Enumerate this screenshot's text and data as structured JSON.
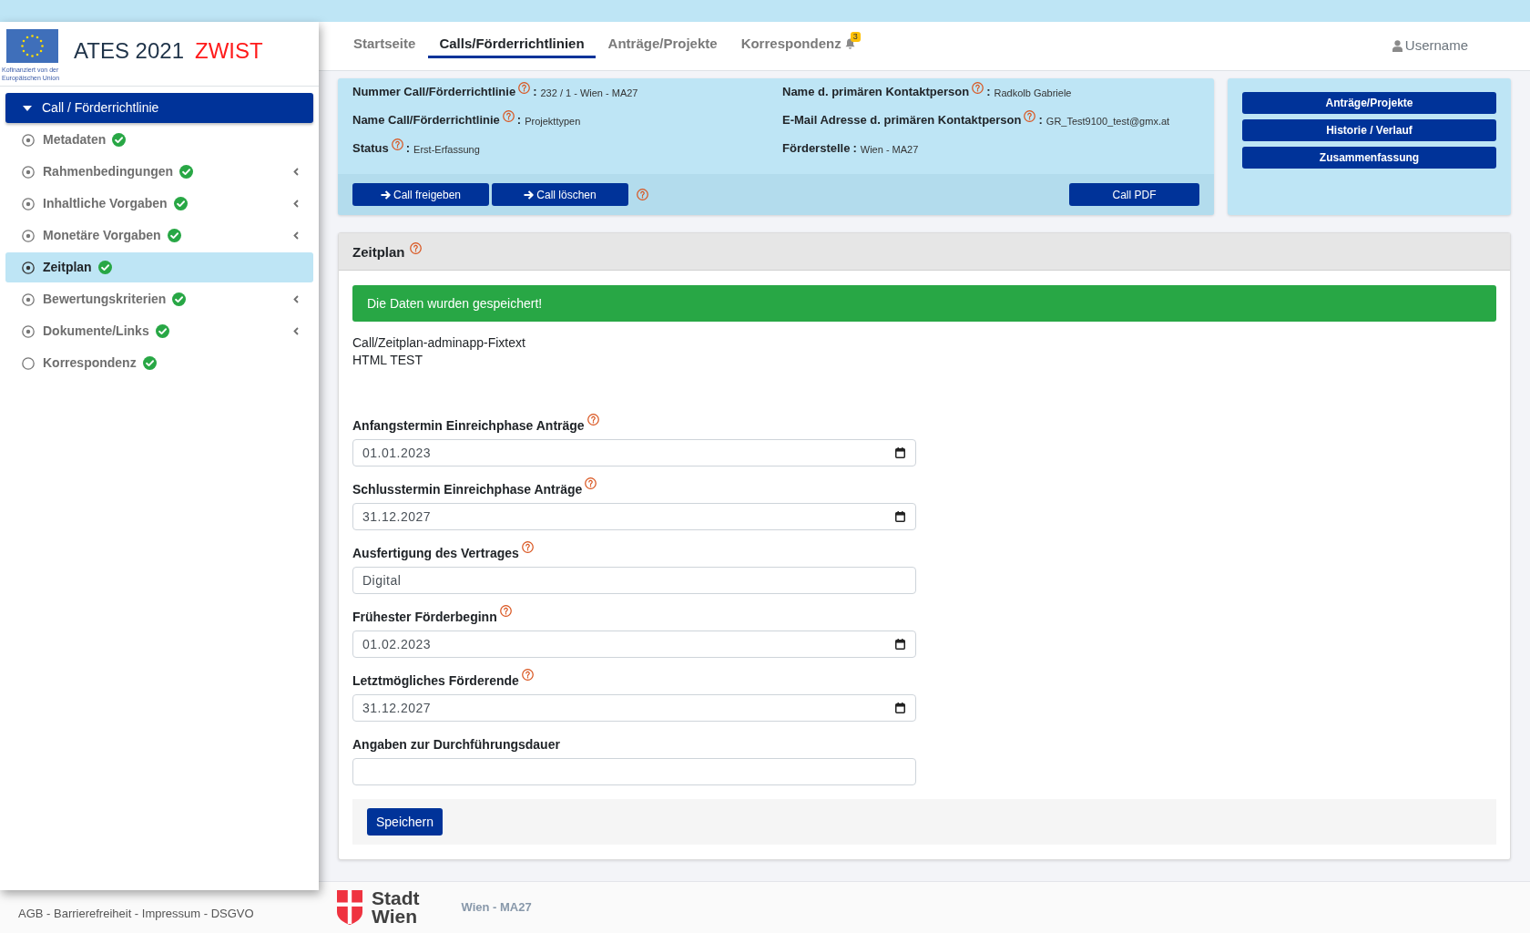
{
  "header": {
    "logo_caption": [
      "Kofinanziert von der",
      "Europäischen Union"
    ],
    "title": "ATES 2021",
    "environment": "ZWIST"
  },
  "sidebar": {
    "section": {
      "label": "Call / Förderrichtlinie",
      "expanded": true
    },
    "items": [
      {
        "label": "Metadaten",
        "selected": false,
        "dot": true,
        "complete": true,
        "submenu": false
      },
      {
        "label": "Rahmenbedingungen",
        "selected": false,
        "dot": true,
        "complete": true,
        "submenu": true
      },
      {
        "label": "Inhaltliche Vorgaben",
        "selected": false,
        "dot": true,
        "complete": true,
        "submenu": true
      },
      {
        "label": "Monetäre Vorgaben",
        "selected": false,
        "dot": true,
        "complete": true,
        "submenu": true
      },
      {
        "label": "Zeitplan",
        "selected": true,
        "dot": true,
        "complete": true,
        "submenu": false
      },
      {
        "label": "Bewertungskriterien",
        "selected": false,
        "dot": true,
        "complete": true,
        "submenu": true
      },
      {
        "label": "Dokumente/Links",
        "selected": false,
        "dot": true,
        "complete": true,
        "submenu": true
      },
      {
        "label": "Korrespondenz",
        "selected": false,
        "dot": false,
        "complete": true,
        "submenu": false
      }
    ]
  },
  "nav": {
    "tabs": [
      {
        "label": "Startseite",
        "selected": false
      },
      {
        "label": "Calls/Förderrichtlinien",
        "selected": true
      },
      {
        "label": "Anträge/Projekte",
        "selected": false
      },
      {
        "label": "Korrespondenz",
        "selected": false,
        "notifications": "3"
      }
    ],
    "user": "Username"
  },
  "call_info": {
    "separator": ":",
    "columns": [
      [
        {
          "label": "Nummer Call/Förderrichtlinie",
          "help": true,
          "value": "232 / 1 - Wien - MA27"
        },
        {
          "label": "Name Call/Förderrichtlinie",
          "help": true,
          "value": "Projekttypen"
        },
        {
          "label": "Status",
          "help": true,
          "value": "Erst-Erfassung"
        }
      ],
      [
        {
          "label": "Name d. primären Kontaktperson",
          "help": true,
          "value": "Radkolb Gabriele"
        },
        {
          "label": "E-Mail Adresse d. primären Kontaktperson",
          "help": true,
          "value": "GR_Test9100_test@gmx.at"
        },
        {
          "label": "Förderstelle",
          "help": false,
          "value": "Wien - MA27"
        }
      ]
    ],
    "actions": [
      "Call freigeben",
      "Call löschen"
    ],
    "actions_help": true,
    "pdf_button": "Call PDF"
  },
  "quick_links": [
    "Anträge/Projekte",
    "Historie / Verlauf",
    "Zusammenfassung"
  ],
  "zeitplan": {
    "title": "Zeitplan",
    "help": true,
    "alert": "Die Daten wurden gespeichert!",
    "fixtext": [
      "Call/Zeitplan-adminapp-Fixtext",
      "HTML TEST"
    ],
    "fields": [
      {
        "label": "Anfangstermin Einreichphase Anträge",
        "help": true,
        "kind": "date",
        "value": "01.01.2023"
      },
      {
        "label": "Schlusstermin Einreichphase Anträge",
        "help": true,
        "kind": "date",
        "value": "31.12.2027"
      },
      {
        "label": "Ausfertigung des Vertrages",
        "help": true,
        "kind": "text",
        "value": "Digital"
      },
      {
        "label": "Frühester Förderbeginn",
        "help": true,
        "kind": "date",
        "value": "01.02.2023"
      },
      {
        "label": "Letztmögliches Förderende",
        "help": true,
        "kind": "date",
        "value": "31.12.2027"
      },
      {
        "label": "Angaben zur Durchführungsdauer",
        "help": false,
        "kind": "text"
      }
    ],
    "save_button": "Speichern"
  },
  "footer": {
    "links": "AGB - Barrierefreiheit - Impressum - DSGVO",
    "logo_text": [
      "Stadt",
      "Wien"
    ],
    "department": "Wien - MA27"
  }
}
